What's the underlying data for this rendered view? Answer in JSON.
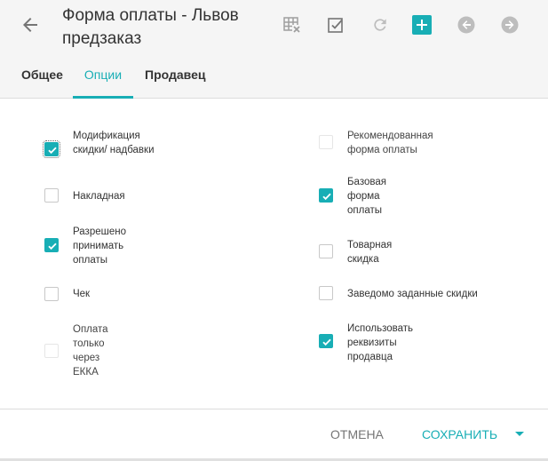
{
  "header": {
    "title": "Форма оплаты - Львов предзаказ"
  },
  "icons": {
    "back": "arrow-left-icon",
    "grid": "table-delete-icon",
    "check": "checkbox-check-icon",
    "refresh": "refresh-icon",
    "add": "plus-icon",
    "prev": "circle-arrow-left-icon",
    "next": "circle-arrow-right-icon"
  },
  "tabs": [
    {
      "label": "Общее"
    },
    {
      "label": "Опции"
    },
    {
      "label": "Продавец"
    }
  ],
  "options": {
    "left": [
      {
        "label": "Модификация скидки/ надбавки",
        "checked": true,
        "disabled": false
      },
      {
        "label": "Накладная",
        "checked": false,
        "disabled": false
      },
      {
        "label": "Разрешено принимать оплаты",
        "checked": true,
        "disabled": false
      },
      {
        "label": "Чек",
        "checked": false,
        "disabled": false
      },
      {
        "label": "Оплата только через ЕККА",
        "checked": false,
        "disabled": true
      }
    ],
    "right": [
      {
        "label": "Рекомендованная форма оплаты",
        "checked": false,
        "disabled": true
      },
      {
        "label": "Базовая форма оплаты",
        "checked": true,
        "disabled": false
      },
      {
        "label": "Товарная скидка",
        "checked": false,
        "disabled": false
      },
      {
        "label": "Заведомо заданные скидки",
        "checked": false,
        "disabled": false
      },
      {
        "label": "Использовать реквизиты продавца",
        "checked": true,
        "disabled": false
      }
    ]
  },
  "footer": {
    "cancel_label": "ОТМЕНА",
    "save_label": "СОХРАНИТЬ"
  },
  "colors": {
    "accent": "#18aeb5",
    "header_bg": "#f5f5f5"
  }
}
